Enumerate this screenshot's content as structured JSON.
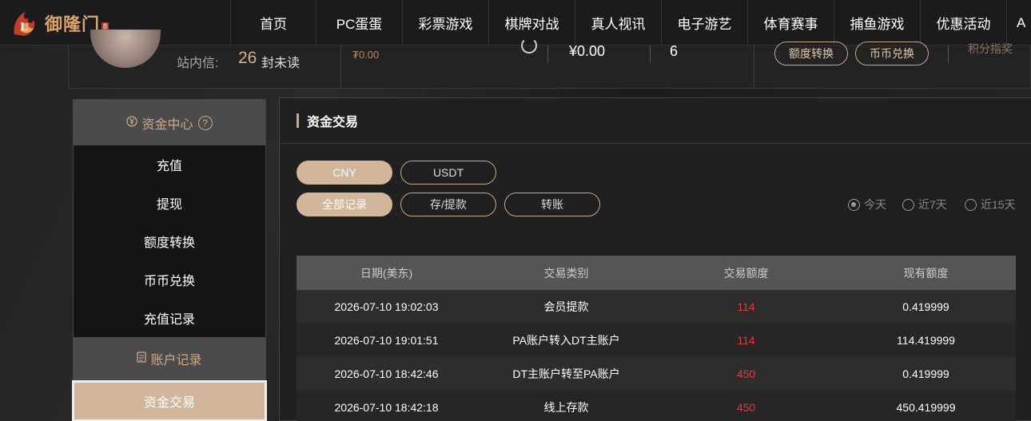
{
  "brand": {
    "name": "御隆门",
    "badge_text": "8"
  },
  "nav": {
    "items": [
      {
        "label": "首页"
      },
      {
        "label": "PC蛋蛋"
      },
      {
        "label": "彩票游戏"
      },
      {
        "label": "棋牌对战"
      },
      {
        "label": "真人视讯"
      },
      {
        "label": "电子游艺"
      },
      {
        "label": "体育赛事"
      },
      {
        "label": "捕鱼游戏"
      },
      {
        "label": "优惠活动"
      },
      {
        "label": "A"
      }
    ]
  },
  "profile": {
    "inbox_label": "站内信:",
    "inbox_count": "26",
    "inbox_unit": "封未读",
    "small_balance": "₮0.00",
    "money": "¥0.00",
    "count": "6",
    "quota_transfer_button": "额度转换",
    "coin_exchange_button": "币币兑换",
    "points_text": "积分指奖"
  },
  "sidebar": {
    "fund_center": "资金中心",
    "help_glyph": "?",
    "items": [
      {
        "label": "充值"
      },
      {
        "label": "提现"
      },
      {
        "label": "额度转换"
      },
      {
        "label": "币币兑换"
      },
      {
        "label": "充值记录"
      }
    ],
    "account_records": "账户记录",
    "active_item": "资金交易"
  },
  "main": {
    "title": "资金交易",
    "currency_tabs": [
      {
        "label": "CNY",
        "active": true
      },
      {
        "label": "USDT",
        "active": false
      }
    ],
    "type_tabs": [
      {
        "label": "全部记录",
        "active": true
      },
      {
        "label": "存/提款",
        "active": false
      },
      {
        "label": "转账",
        "active": false
      }
    ],
    "range_options": [
      {
        "label": "今天",
        "selected": true
      },
      {
        "label": "近7天",
        "selected": false
      },
      {
        "label": "近15天",
        "selected": false
      }
    ]
  },
  "table": {
    "headers": [
      "日期(美东)",
      "交易类别",
      "交易额度",
      "现有额度"
    ],
    "rows": [
      [
        "2026-07-10 19:02:03",
        "会员提款",
        "114",
        "0.419999"
      ],
      [
        "2026-07-10 19:01:51",
        "PA账户转入DT主账户",
        "114",
        "114.419999"
      ],
      [
        "2026-07-10 18:42:46",
        "DT主账户转至PA账户",
        "450",
        "0.419999"
      ],
      [
        "2026-07-10 18:42:18",
        "线上存款",
        "450",
        "450.419999"
      ]
    ]
  },
  "colors": {
    "accent": "#d2b69a",
    "amount_red": "#e23b3b",
    "gold_text": "#cfa783"
  }
}
